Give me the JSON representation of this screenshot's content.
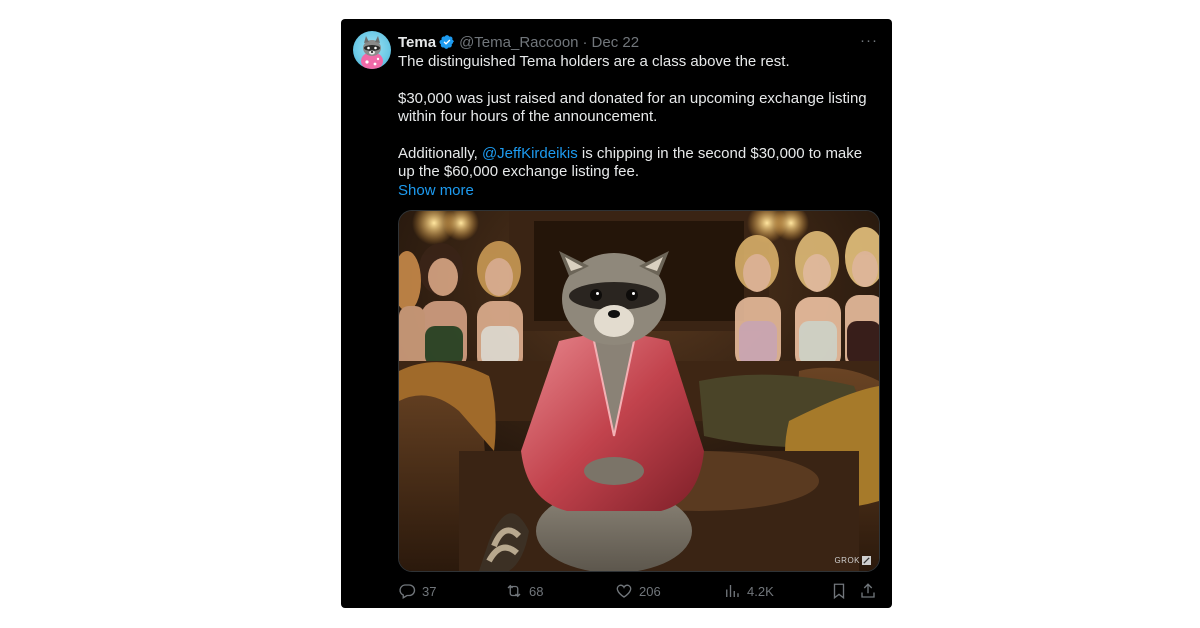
{
  "tweet": {
    "name": "Tema",
    "handle": "@Tema_Raccoon",
    "separator": "·",
    "date": "Dec 22",
    "more_label": "···",
    "text": {
      "line1": "The distinguished Tema holders are a class above the rest.",
      "para2": "$30,000 was just raised and donated for an upcoming exchange listing within four hours of the announcement.",
      "para3_prefix": "Additionally, ",
      "mention": "@JeffKirdeikis",
      "para3_suffix": " is chipping in the second $30,000 to make up the $60,000 exchange listing fee.",
      "show_more": "Show more"
    },
    "media": {
      "watermark": "GROK"
    },
    "actions": {
      "replies": "37",
      "reposts": "68",
      "likes": "206",
      "views": "4.2K"
    },
    "colors": {
      "background": "#000000",
      "text": "#e7e9ea",
      "muted": "#71767b",
      "link": "#1d9bf0",
      "verified": "#1d9bf0"
    }
  }
}
